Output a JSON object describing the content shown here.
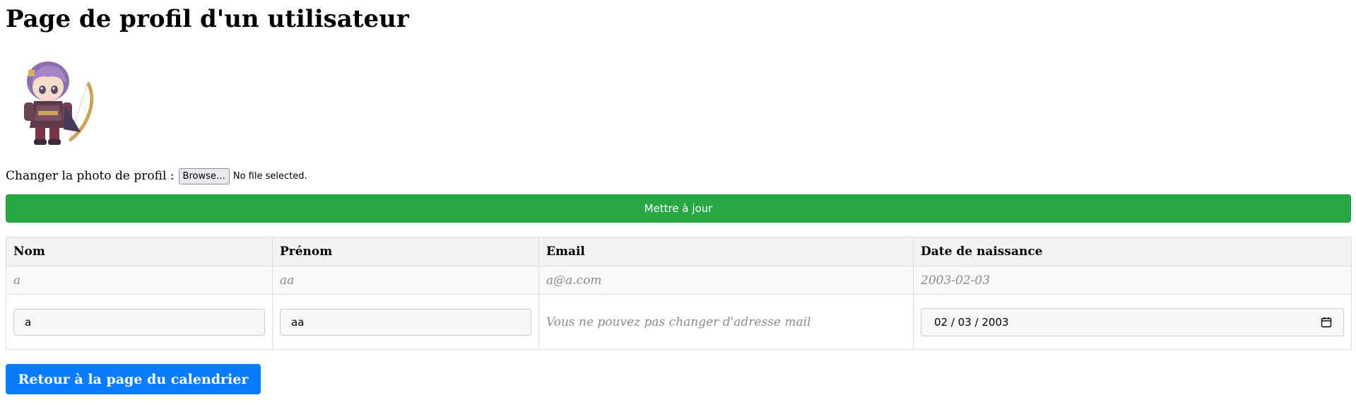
{
  "page": {
    "title": "Page de profil d'un utilisateur"
  },
  "upload": {
    "label": "Changer la photo de profil :",
    "browse_label": "Browse…",
    "file_status": "No file selected."
  },
  "update_button": "Mettre à jour",
  "table": {
    "headers": [
      "Nom",
      "Prénom",
      "Email",
      "Date de naissance"
    ],
    "display_row": [
      "a",
      "aa",
      "a@a.com",
      "2003-02-03"
    ],
    "edit_row": {
      "nom_value": "a",
      "prenom_value": "aa",
      "email_note": "Vous ne pouvez pas changer d'adresse mail",
      "date_value": "02 / 03 / 2003"
    }
  },
  "back_button": "Retour à la page du calendrier",
  "colors": {
    "update_green": "#28a745",
    "back_blue": "#0a7cff"
  },
  "icons": {
    "avatar": "chibi-archer-avatar",
    "date_picker": "calendar-icon"
  }
}
